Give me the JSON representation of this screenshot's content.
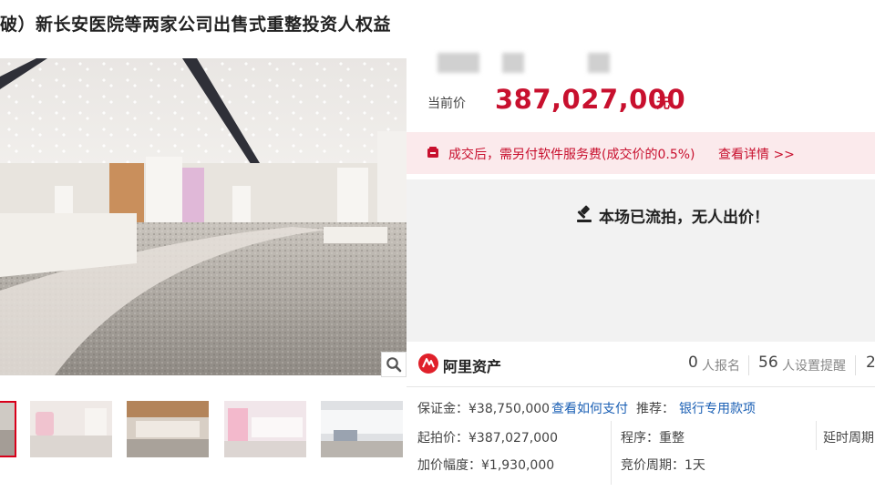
{
  "page": {
    "title": "破）新长安医院等两家公司出售式重整投资人权益"
  },
  "price": {
    "label": "当前价",
    "value": "387,027,000",
    "unit": "元"
  },
  "fee_notice": {
    "text": "成交后，需另付软件服务费(成交价的0.5%)",
    "link": "查看详情 >>"
  },
  "status": {
    "text": "本场已流拍，无人出价！"
  },
  "brand": {
    "name": "阿里资产"
  },
  "stats": {
    "signups_count": "0",
    "signups_label": "人报名",
    "reminders_count": "56",
    "reminders_label": "人设置提醒",
    "views_count": "2"
  },
  "info": {
    "deposit": "保证金：¥38,750,000",
    "pay_link": "查看如何支付",
    "recommend_label": "推荐：",
    "recommend_link": "银行专用款项",
    "start_price": "起拍价：¥387,027,000",
    "procedure": "程序：重整",
    "delay_cycle": "延时周期",
    "increment": "加价幅度：¥1,930,000",
    "bid_period": "竞价周期：1天"
  },
  "colors": {
    "accent": "#c8102e",
    "link": "#1a5fb4",
    "fee_bg": "#fbeaec",
    "status_bg": "#f2f2f2"
  },
  "icons": {
    "zoom": "magnifier-icon",
    "fee": "wallet-icon",
    "status": "gavel-icon",
    "brand": "ali-asset-logo-icon"
  },
  "thumbnails": [
    {
      "name": "thumb-1",
      "selected": true
    },
    {
      "name": "thumb-2",
      "selected": false
    },
    {
      "name": "thumb-3",
      "selected": false
    },
    {
      "name": "thumb-4",
      "selected": false
    },
    {
      "name": "thumb-5",
      "selected": false
    }
  ]
}
